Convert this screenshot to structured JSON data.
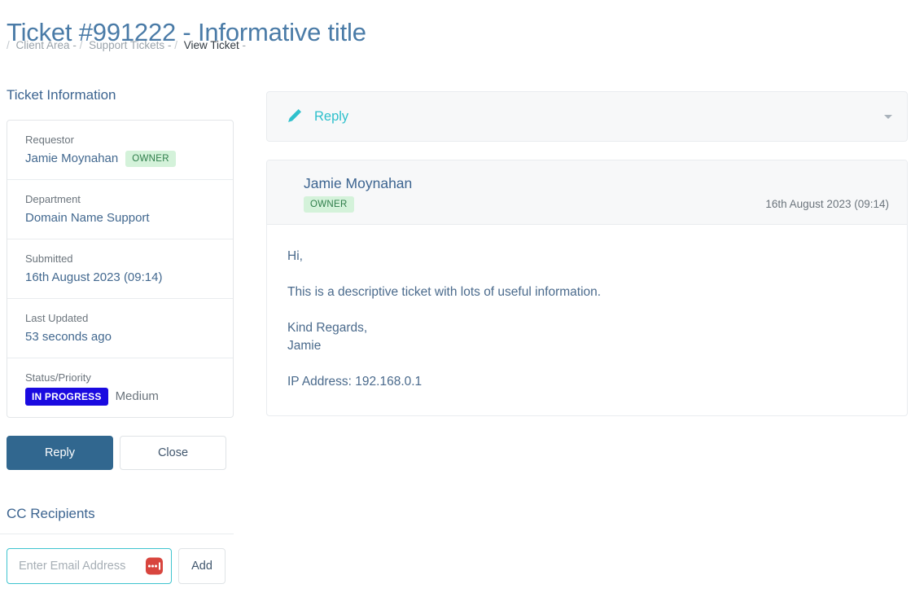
{
  "header": {
    "title": "Ticket #991222 - Informative title",
    "breadcrumb": [
      {
        "label": "Client Area",
        "active": false
      },
      {
        "label": "Support Tickets",
        "active": false
      },
      {
        "label": "View Ticket",
        "active": true
      }
    ]
  },
  "sidebar": {
    "ticket_information_heading": "Ticket Information",
    "info_rows": [
      {
        "label": "Requestor",
        "value": "Jamie Moynahan",
        "badge": "OWNER"
      },
      {
        "label": "Department",
        "value": "Domain Name Support"
      },
      {
        "label": "Submitted",
        "value": "16th August 2023 (09:14)"
      },
      {
        "label": "Last Updated",
        "value": "53 seconds ago"
      }
    ],
    "status_row": {
      "label": "Status/Priority",
      "status": "IN PROGRESS",
      "priority": "Medium"
    },
    "buttons": {
      "reply": "Reply",
      "close": "Close"
    },
    "cc": {
      "heading": "CC Recipients",
      "email_placeholder": "Enter Email Address",
      "email_value": "",
      "add_label": "Add",
      "password_manager_icon": "password-manager-icon"
    }
  },
  "main": {
    "reply_bar": {
      "label": "Reply",
      "pencil_icon": "pencil-icon",
      "caret_icon": "chevron-down-icon"
    },
    "message": {
      "author": "Jamie Moynahan",
      "badge": "OWNER",
      "date": "16th August 2023 (09:14)",
      "paragraphs": [
        "Hi,",
        "This is a descriptive ticket with lots of useful information.",
        "Kind Regards,\nJamie",
        "IP Address: 192.168.0.1"
      ]
    }
  },
  "colors": {
    "title_blue": "#4a7ba7",
    "heading_blue": "#3c6490",
    "primary_button": "#31678f",
    "teal_accent": "#2ec0cc",
    "status_badge_bg": "#1a0ae0",
    "owner_badge_bg": "#d4f2da",
    "owner_badge_text": "#2e7d4a",
    "password_icon_red": "#d8453e"
  }
}
